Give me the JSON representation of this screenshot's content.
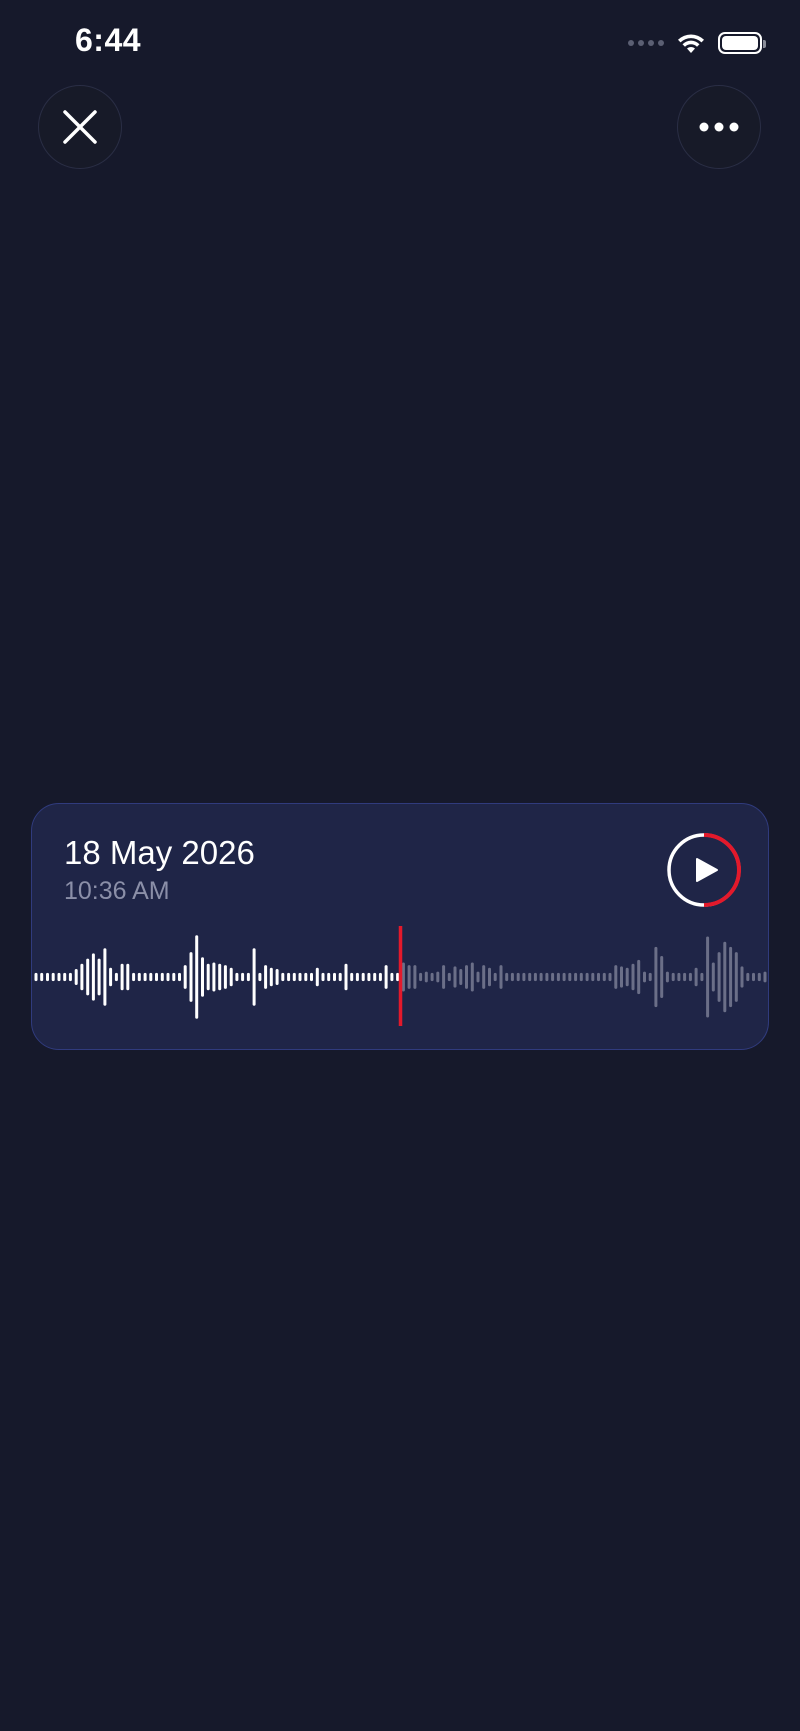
{
  "status_bar": {
    "time": "6:44",
    "icons": [
      "cellular-signal-icon",
      "wifi-icon",
      "battery-icon"
    ]
  },
  "toolbar": {
    "close_icon": "close-icon",
    "more_icon": "more-options-icon"
  },
  "recording": {
    "date": "18 May 2026",
    "time": "10:36 AM",
    "playback_progress": 0.5,
    "play_icon": "play-icon"
  },
  "colors": {
    "background": "#16192b",
    "card": "#1f2547",
    "card_border": "#303b7d",
    "accent": "#e3192b",
    "played_wave": "#ffffff",
    "unplayed_wave": "#6b6f88",
    "secondary_text": "#8b8fa8"
  }
}
